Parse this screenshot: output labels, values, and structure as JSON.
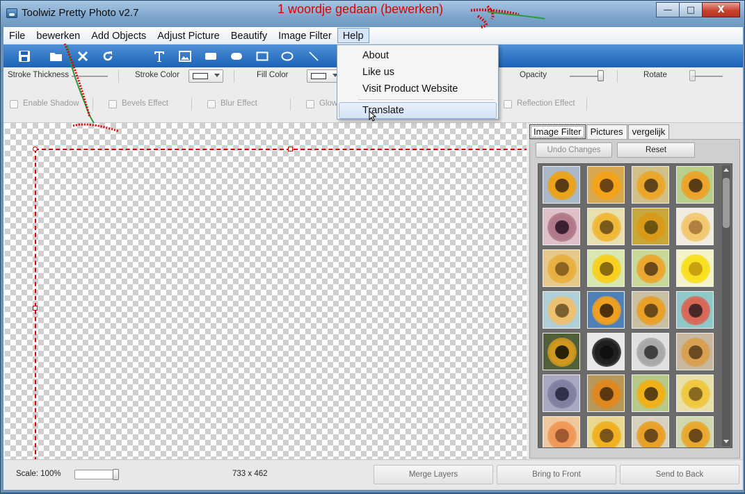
{
  "window": {
    "title": "Toolwiz Pretty Photo v2.7",
    "annotation": "1 woordje gedaan (bewerken)",
    "buttons": {
      "minimize": "—",
      "maximize": "□",
      "close": "X"
    }
  },
  "menu": {
    "items": [
      "File",
      "bewerken",
      "Add Objects",
      "Adjust Picture",
      "Beautify",
      "Image Filter",
      "Help"
    ],
    "open_item": "Help"
  },
  "help_menu": {
    "items": [
      "About",
      "Like us",
      "Visit Product Website",
      "Translate"
    ],
    "hovered": "Translate"
  },
  "toolbar": {
    "icons": [
      "save-icon",
      "open-folder-icon",
      "delete-icon",
      "refresh-icon",
      "text-icon",
      "image-icon",
      "filled-rect-icon",
      "rounded-rect-icon",
      "rectangle-icon",
      "ellipse-icon",
      "line-icon"
    ]
  },
  "properties": {
    "stroke_thickness": "Stroke Thickness",
    "stroke_color": "Stroke Color",
    "fill_color": "Fill Color",
    "opacity": "Opacity",
    "rotate": "Rotate",
    "enable_shadow": "Enable Shadow",
    "bevels_effect": "Bevels Effect",
    "blur_effect": "Blur Effect",
    "glow_effect": "Glow",
    "reflection_effect": "Reflection Effect",
    "opacity_value": 1.0,
    "rotate_value": 0.0
  },
  "side_panel": {
    "tabs": [
      "Image Filter",
      "Pictures",
      "vergelijk"
    ],
    "active_tab": "Image Filter",
    "undo_label": "Undo Changes",
    "reset_label": "Reset"
  },
  "filters": [
    {
      "bg": "#aab8c8",
      "petals": "#e9a41c",
      "center": "#5a3a12"
    },
    {
      "bg": "#d8a850",
      "petals": "#f3a21a",
      "center": "#6a4214"
    },
    {
      "bg": "#d2c08a",
      "petals": "#eaa72a",
      "center": "#5e4418"
    },
    {
      "bg": "#b8d08c",
      "petals": "#eca32a",
      "center": "#5a3c14"
    },
    {
      "bg": "#e0c0c8",
      "petals": "#b07888",
      "center": "#3a2030"
    },
    {
      "bg": "#e8e0b0",
      "petals": "#f0b838",
      "center": "#7a5a1c"
    },
    {
      "bg": "#c8a838",
      "petals": "#d89a18",
      "center": "#6a5410"
    },
    {
      "bg": "#f0ece0",
      "petals": "#f2c870",
      "center": "#b08040"
    },
    {
      "bg": "#e6c888",
      "petals": "#e8b040",
      "center": "#8a6420"
    },
    {
      "bg": "#d8e8b0",
      "petals": "#f8d020",
      "center": "#8a6a10"
    },
    {
      "bg": "#c8d898",
      "petals": "#eaa830",
      "center": "#6a4818"
    },
    {
      "bg": "#f4f2c8",
      "petals": "#f8e020",
      "center": "#c8a010"
    },
    {
      "bg": "#b0d0d8",
      "petals": "#ecc070",
      "center": "#7a6030"
    },
    {
      "bg": "#5080b8",
      "petals": "#f0a020",
      "center": "#4a3010"
    },
    {
      "bg": "#c8c0a0",
      "petals": "#e8a028",
      "center": "#6a4a18"
    },
    {
      "bg": "#90c8c8",
      "petals": "#d86858",
      "center": "#4a2828"
    },
    {
      "bg": "#506038",
      "petals": "#d09820",
      "center": "#2a2008"
    },
    {
      "bg": "#e8e8e8",
      "petals": "#202020",
      "center": "#101010"
    },
    {
      "bg": "#e0e0e0",
      "petals": "#a8a8a8",
      "center": "#404040"
    },
    {
      "bg": "#c8b8a0",
      "petals": "#d8a050",
      "center": "#6a4a20"
    },
    {
      "bg": "#a8a8c0",
      "petals": "#8080a0",
      "center": "#303048"
    },
    {
      "bg": "#b89858",
      "petals": "#e08820",
      "center": "#5a3812"
    },
    {
      "bg": "#b8c888",
      "petals": "#f0b018",
      "center": "#5a4014"
    },
    {
      "bg": "#e8e0a8",
      "petals": "#f0c840",
      "center": "#8a6a20"
    },
    {
      "bg": "#f0c8a0",
      "petals": "#f09858",
      "center": "#a05830"
    },
    {
      "bg": "#e8d890",
      "petals": "#f0b020",
      "center": "#7a5418"
    },
    {
      "bg": "#d8d0c0",
      "petals": "#e8a028",
      "center": "#6a4818"
    },
    {
      "bg": "#d0d8b0",
      "petals": "#e8a830",
      "center": "#6a4818"
    }
  ],
  "status": {
    "scale": "Scale: 100%",
    "dimensions": "733 x 462",
    "merge_layers": "Merge Layers",
    "bring_to_front": "Bring to Front",
    "send_to_back": "Send to Back"
  },
  "colors": {
    "accent": "#1b63b8",
    "annotation_red": "#e10000",
    "annotation_green": "#2a9a3a",
    "selection": "#dd0000"
  }
}
